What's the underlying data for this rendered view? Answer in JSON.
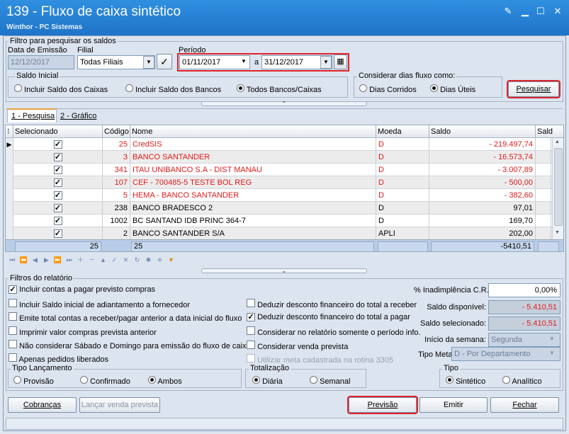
{
  "window": {
    "title": "139 - Fluxo de caixa sintético",
    "subtitle": "Winthor - PC Sistemas"
  },
  "filters": {
    "group_title": "Filtro para pesquisar os saldos",
    "emission_label": "Data de Emissão",
    "emission_value": "12/12/2017",
    "filial_label": "Filial",
    "filial_value": "Todas Filiais",
    "periodo_label": "Período",
    "period_start": "01/11/2017",
    "period_sep": "a",
    "period_end": "31/12/2017",
    "saldo_title": "Saldo Inicial",
    "saldo_options": [
      "Incluir Saldo dos Caixas",
      "Incluir Saldo dos Bancos",
      "Todos Bancos/Caixas"
    ],
    "dias_title": "Considerar dias fluxo como:",
    "dias_options": [
      "Dias Corridos",
      "Dias Úteis"
    ],
    "search_button": "Pesquisar"
  },
  "tabs": [
    "1 - Pesquisa",
    "2 - Gráfico"
  ],
  "grid": {
    "headers": [
      "Selecionado",
      "Código",
      "Nome",
      "Moeda",
      "Saldo",
      "Sald"
    ],
    "rows": [
      {
        "codigo": "25",
        "nome": "CredSIS",
        "moeda": "D",
        "saldo": "- 219.497,74",
        "neg": true
      },
      {
        "codigo": "3",
        "nome": "BANCO SANTANDER",
        "moeda": "D",
        "saldo": "- 16.573,74",
        "neg": true
      },
      {
        "codigo": "341",
        "nome": "ITAU UNIBANCO S.A - DIST MANAU",
        "moeda": "D",
        "saldo": "- 3.007,89",
        "neg": true
      },
      {
        "codigo": "107",
        "nome": "CEF - 700485-5 TESTE BOL REG",
        "moeda": "D",
        "saldo": "- 500,00",
        "neg": true
      },
      {
        "codigo": "5",
        "nome": "HEMA - BANCO SANTANDER",
        "moeda": "D",
        "saldo": "- 382,60",
        "neg": true
      },
      {
        "codigo": "238",
        "nome": "BANCO BRADESCO 2",
        "moeda": "D",
        "saldo": "97,01",
        "neg": false
      },
      {
        "codigo": "1002",
        "nome": "BC SANTAND IDB PRINC 364-7",
        "moeda": "D",
        "saldo": "169,70",
        "neg": false
      },
      {
        "codigo": "2",
        "nome": "BANCO SANTANDER S/A",
        "moeda": "APLI",
        "saldo": "202,00",
        "neg": false
      }
    ],
    "footer_count": "25",
    "footer_nome": "25",
    "footer_saldo": "-5410,51"
  },
  "report": {
    "title": "Filtros do relatório",
    "left_checks": [
      {
        "label": "Incluir contas a pagar previsto compras",
        "checked": true
      },
      {
        "label": "Incluir Saldo inicial de adiantamento a fornecedor",
        "checked": false
      },
      {
        "label": "Emite total contas a receber/pagar anterior a data inicial do fluxo",
        "checked": false
      },
      {
        "label": "Imprimir valor compras prevista anterior",
        "checked": false
      },
      {
        "label": "Não considerar Sábado e Domingo para emissão do fluxo de caixa",
        "checked": false
      },
      {
        "label": "Apenas pedidos liberados",
        "checked": false
      }
    ],
    "mid_checks": [
      {
        "label": "Deduzir desconto financeiro do total a receber",
        "checked": false
      },
      {
        "label": "Deduzir desconto financeiro do total a pagar",
        "checked": true
      },
      {
        "label": "Considerar no relatório somente o período info.",
        "checked": false
      },
      {
        "label": "Considerar venda prevista",
        "checked": false
      },
      {
        "label": "Utilizar meta cadastrada na rotina 3305",
        "checked": false
      }
    ],
    "inadimplencia_label": "% Inadimplência C.R.",
    "inadimplencia_value": "0,00%",
    "saldo_disp_label": "Saldo disponível:",
    "saldo_disp_value": "- 5.410,51",
    "saldo_sel_label": "Saldo selecionado:",
    "saldo_sel_value": "- 5.410,51",
    "inicio_label": "Início da semana:",
    "inicio_value": "Segunda",
    "tipo_meta_label": "Tipo Meta:",
    "tipo_meta_value": "D - Por Departamento",
    "lancamento_title": "Tipo Lançamento",
    "lancamento_options": [
      "Provisão",
      "Confirmado",
      "Ambos"
    ],
    "totalizacao_title": "Totalização",
    "totalizacao_options": [
      "Diária",
      "Semanal"
    ],
    "tipo_title": "Tipo",
    "tipo_options": [
      "Sintético",
      "Analítico"
    ]
  },
  "buttons": {
    "cobrancas": "Cobranças",
    "lancar": "Lançar venda prevista",
    "previsao": "Previsão",
    "emitir": "Emitir",
    "fechar": "Fechar"
  },
  "colors": {
    "title_bar": "#1f74c8",
    "negative": "#e01b1b",
    "highlight": "#e0222a"
  }
}
